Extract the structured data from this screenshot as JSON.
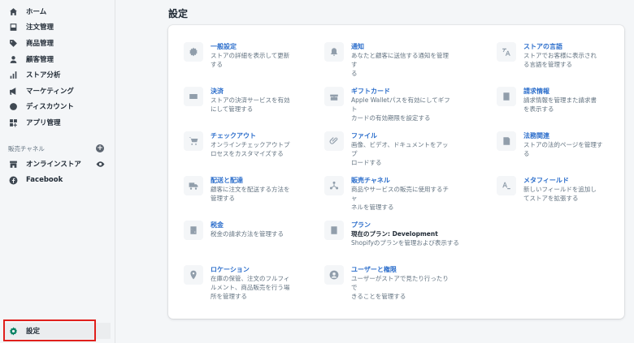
{
  "sidebar": {
    "items": [
      {
        "label": "ホーム",
        "icon": "home-icon"
      },
      {
        "label": "注文管理",
        "icon": "orders-icon"
      },
      {
        "label": "商品管理",
        "icon": "tag-icon"
      },
      {
        "label": "顧客管理",
        "icon": "person-icon"
      },
      {
        "label": "ストア分析",
        "icon": "bar-chart-icon"
      },
      {
        "label": "マーケティング",
        "icon": "megaphone-icon"
      },
      {
        "label": "ディスカウント",
        "icon": "discount-icon"
      },
      {
        "label": "アプリ管理",
        "icon": "apps-icon"
      }
    ],
    "sales_channels_label": "販売チャネル",
    "channels": [
      {
        "label": "オンラインストア",
        "icon": "store-icon"
      },
      {
        "label": "Facebook",
        "icon": "facebook-icon"
      }
    ],
    "settings_label": "設定"
  },
  "page": {
    "title": "設定"
  },
  "tiles": [
    {
      "title": "一般設定",
      "desc": "ストアの詳細を表示して更新\nする",
      "icon": "gear-icon"
    },
    {
      "title": "通知",
      "desc": "あなたと顧客に送信する通知を管理す\nる",
      "icon": "bell-icon"
    },
    {
      "title": "ストアの言語",
      "desc": "ストアでお客様に表示され\nる言語を管理する",
      "icon": "translate-icon"
    },
    {
      "title": "決済",
      "desc": "ストアの決済サービスを有効\nにして管理する",
      "icon": "payment-icon"
    },
    {
      "title": "ギフトカード",
      "desc": "Apple Walletパスを有効にしてギフト\nカードの有効期限を設定する",
      "icon": "gift-icon"
    },
    {
      "title": "請求情報",
      "desc": "請求情報を管理また請求書\nを表示する",
      "icon": "billing-icon"
    },
    {
      "title": "チェックアウト",
      "desc": "オンラインチェックアウトプ\nロセスをカスタマイズする",
      "icon": "cart-icon"
    },
    {
      "title": "ファイル",
      "desc": "画像、ビデオ、ドキュメントをアップ\nロードする",
      "icon": "paperclip-icon"
    },
    {
      "title": "法務関連",
      "desc": "ストアの法的ページを管理す\nる",
      "icon": "legal-icon"
    },
    {
      "title": "配送と配達",
      "desc": "顧客に注文を配送する方法を\n管理する",
      "icon": "truck-icon"
    },
    {
      "title": "販売チャネル",
      "desc": "商品やサービスの販売に使用するチャ\nネルを管理する",
      "icon": "channels-icon"
    },
    {
      "title": "メタフィールド",
      "desc": "新しいフィールドを追加し\nてストアを拡張する",
      "icon": "metafields-icon"
    },
    {
      "title": "税金",
      "desc": "税金の請求方法を管理する",
      "icon": "tax-icon"
    },
    {
      "title": "プラン",
      "sub": "現在のプラン: Development",
      "desc": "Shopifyのプランを管理および表示する",
      "icon": "plan-icon"
    },
    {
      "title": "ロケーション",
      "desc": "在庫の保管、注文のフルフィ\nルメント、商品販売を行う場\n所を管理する",
      "icon": "location-icon"
    },
    {
      "title": "ユーザーと権限",
      "desc": "ユーザーがストアで見たり行ったりで\nきることを管理する",
      "icon": "user-icon"
    }
  ],
  "colors": {
    "accent": "#2c6ecb",
    "highlight": "#e0201c",
    "settings_icon": "#008060"
  }
}
